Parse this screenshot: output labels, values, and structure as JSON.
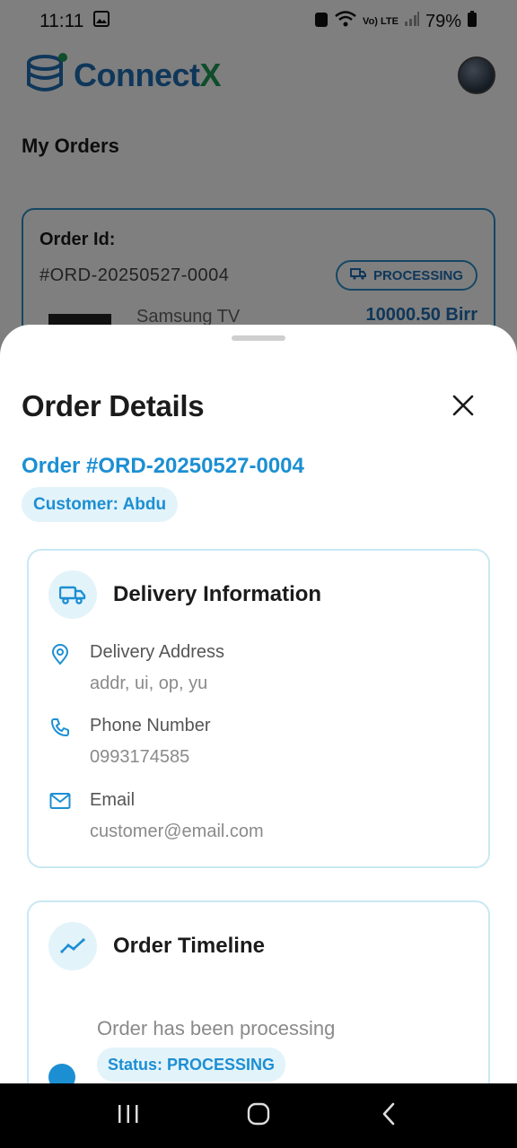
{
  "status_bar": {
    "time": "11:11",
    "battery": "79%",
    "network": "Vo) LTE"
  },
  "app": {
    "brand_part1": "Connect",
    "brand_part2": "X",
    "page_title": "My Orders"
  },
  "background_order": {
    "id_label": "Order Id:",
    "id_value": "#ORD-20250527-0004",
    "status": "PROCESSING",
    "product": "Samsung TV",
    "price": "10000.50 Birr"
  },
  "sheet": {
    "title": "Order Details",
    "order_number": "Order #ORD-20250527-0004",
    "customer": "Customer: Abdu"
  },
  "delivery": {
    "title": "Delivery Information",
    "address_label": "Delivery Address",
    "address_value": "addr, ui, op, yu",
    "phone_label": "Phone Number",
    "phone_value": "0993174585",
    "email_label": "Email",
    "email_value": "customer@email.com"
  },
  "timeline": {
    "title": "Order Timeline",
    "event_text": "Order has been processing",
    "event_status": "Status: PROCESSING"
  },
  "colors": {
    "accent": "#1c8fd3",
    "chip_bg": "#e3f3fa",
    "card_border": "#c9e8f4",
    "brand_blue": "#1f6fb5",
    "brand_green": "#1e9a57"
  }
}
